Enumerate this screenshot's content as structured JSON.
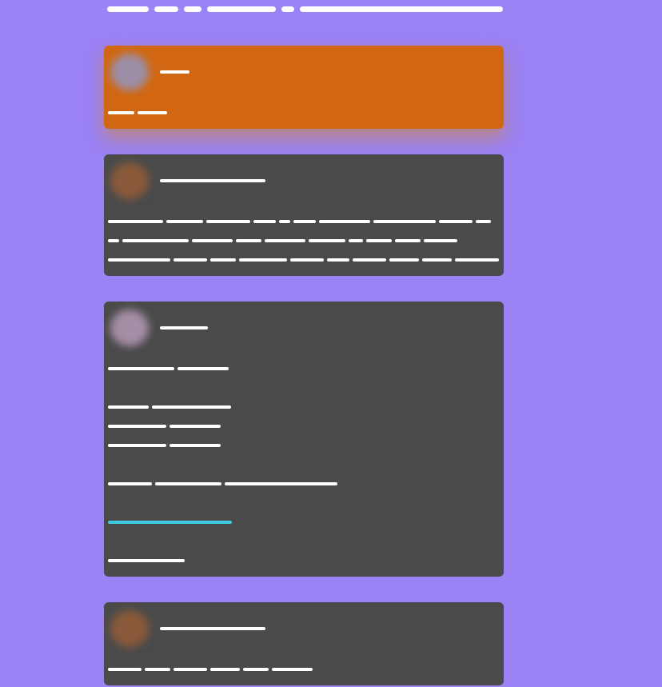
{
  "page": {
    "background": "#9b82f5",
    "accent_link_color": "#3ccbe0"
  },
  "header": {
    "redacted_segments": [
      {
        "width": 52
      },
      {
        "width": 30
      },
      {
        "width": 22
      },
      {
        "width": 86
      },
      {
        "width": 16
      },
      {
        "width": 254
      }
    ]
  },
  "posts": [
    {
      "highlighted": true,
      "card_color": "#d16712",
      "avatar": {
        "icon": "user-avatar-icon",
        "color": "#9b8ea6"
      },
      "author_name_segments": [
        {
          "width": 37
        }
      ],
      "body_lines": [
        [
          {
            "width": 33
          },
          {
            "width": 37
          }
        ]
      ]
    },
    {
      "highlighted": false,
      "card_color": "#4a4a4a",
      "avatar": {
        "icon": "user-avatar-icon",
        "color": "#8a5a3a"
      },
      "author_name_segments": [
        {
          "width": 132
        }
      ],
      "body_lines": [
        [
          {
            "width": 69
          },
          {
            "width": 46
          },
          {
            "width": 55
          },
          {
            "width": 28
          },
          {
            "width": 14
          },
          {
            "width": 28
          },
          {
            "width": 64
          },
          {
            "width": 78
          },
          {
            "width": 42
          },
          {
            "width": 19
          }
        ],
        [
          {
            "width": 14
          },
          {
            "width": 83
          },
          {
            "width": 51
          },
          {
            "width": 32
          },
          {
            "width": 51
          },
          {
            "width": 46
          },
          {
            "width": 18
          },
          {
            "width": 32
          },
          {
            "width": 32
          },
          {
            "width": 42
          }
        ],
        [
          {
            "width": 78
          },
          {
            "width": 42
          },
          {
            "width": 32
          },
          {
            "width": 60
          },
          {
            "width": 42
          },
          {
            "width": 28
          },
          {
            "width": 42
          },
          {
            "width": 37
          },
          {
            "width": 37
          },
          {
            "width": 55
          }
        ]
      ]
    },
    {
      "highlighted": false,
      "card_color": "#4a4a4a",
      "avatar": {
        "icon": "user-avatar-icon",
        "color": "#a58ea6"
      },
      "author_name_segments": [
        {
          "width": 60
        }
      ],
      "body_lines": [
        [
          {
            "width": 83
          },
          {
            "width": 64
          }
        ],
        [],
        [
          {
            "width": 51
          },
          {
            "width": 99
          }
        ],
        [
          {
            "width": 73
          },
          {
            "width": 64
          }
        ],
        [
          {
            "width": 73
          },
          {
            "width": 64
          }
        ],
        [],
        [
          {
            "width": 55
          },
          {
            "width": 83
          },
          {
            "width": 141
          }
        ],
        [],
        [
          {
            "width": 155,
            "accent": true,
            "link": true
          }
        ],
        [],
        [
          {
            "width": 96
          }
        ]
      ]
    },
    {
      "highlighted": false,
      "card_color": "#4a4a4a",
      "avatar": {
        "icon": "user-avatar-icon",
        "color": "#8a5a3a"
      },
      "author_name_segments": [
        {
          "width": 132
        }
      ],
      "body_lines": [
        [
          {
            "width": 42
          },
          {
            "width": 32
          },
          {
            "width": 42
          },
          {
            "width": 37
          },
          {
            "width": 32
          },
          {
            "width": 51
          }
        ]
      ]
    }
  ]
}
